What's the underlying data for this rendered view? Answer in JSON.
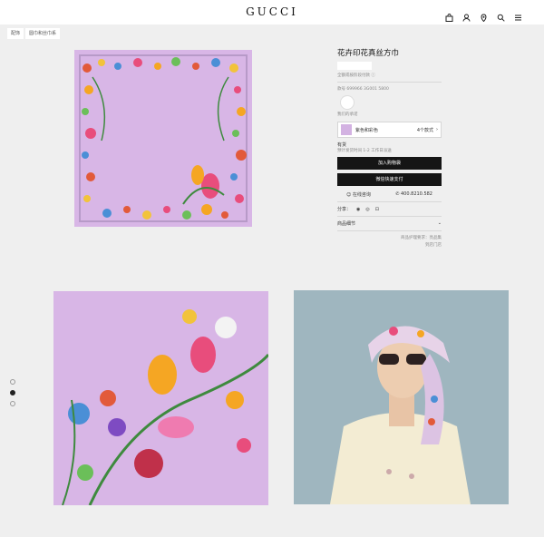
{
  "header": {
    "logo": "GUCCI",
    "icons": [
      "bag-icon",
      "user-icon",
      "location-icon",
      "search-icon",
      "menu-icon"
    ]
  },
  "breadcrumb": {
    "items": [
      "配饰",
      "圆巾和丝巾系"
    ]
  },
  "product": {
    "title": "花卉印花真丝方巾",
    "price": "",
    "installment_note": "全额或按阶段付款 ⓘ",
    "style_code": "款号 699966 3G001 5800",
    "swatch_label": "我们的承诺",
    "color_name": "紫色和彩色",
    "color_count": "4个款式",
    "stock_label": "有货",
    "stock_note": "预计发货时间 1-2 工作日派送",
    "add_to_cart": "加入购物袋",
    "wechat_pay": "微信快速支付",
    "consult": "在线咨询",
    "phone": "400.8210.582",
    "share_label": "分享：",
    "details_label": "商品细节",
    "care_link": "商品护理要求：亮品集",
    "store_link": "到店门店",
    "accent": "#151515"
  },
  "carousel": {
    "count": 3,
    "active_index": 1
  }
}
